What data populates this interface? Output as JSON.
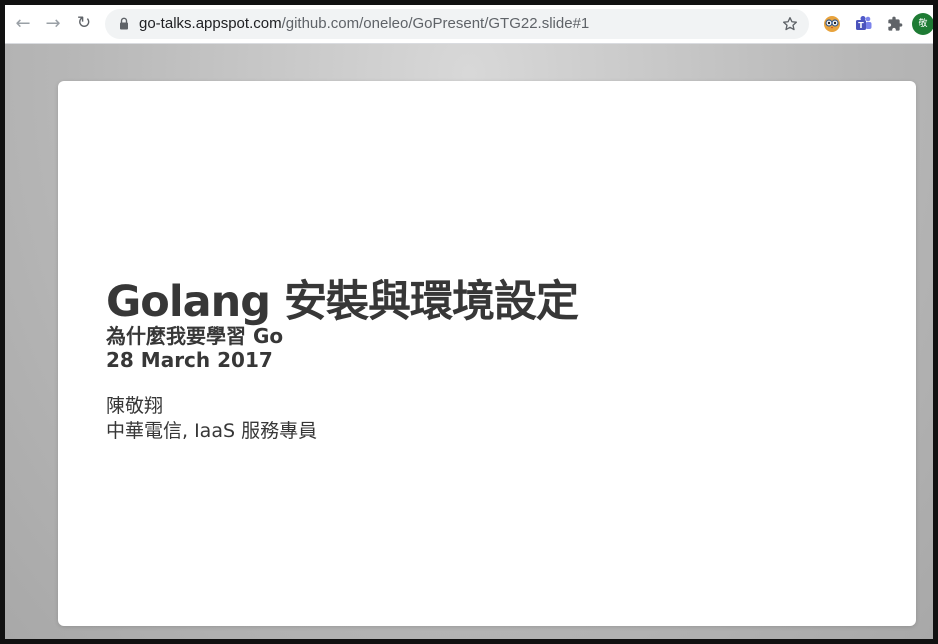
{
  "browser": {
    "url_host": "go-talks.appspot.com",
    "url_path": "/github.com/oneleo/GoPresent/GTG22.slide#1",
    "icons": {
      "back": "arrow-left-icon",
      "forward": "arrow-right-icon",
      "reload": "reload-icon",
      "lock": "lock-icon",
      "bookmark": "star-icon",
      "extensions": [
        "owl-extension-icon",
        "teams-extension-icon",
        "puzzle-extension-icon"
      ]
    },
    "profile_avatar_text": "敬",
    "avatar_color": "#1e7b34"
  },
  "slide": {
    "title": "Golang 安裝與環境設定",
    "subtitle": "為什麼我要學習 Go",
    "date": "28 March 2017",
    "author": "陳敬翔",
    "affiliation": "中華電信, IaaS 服務專員"
  }
}
